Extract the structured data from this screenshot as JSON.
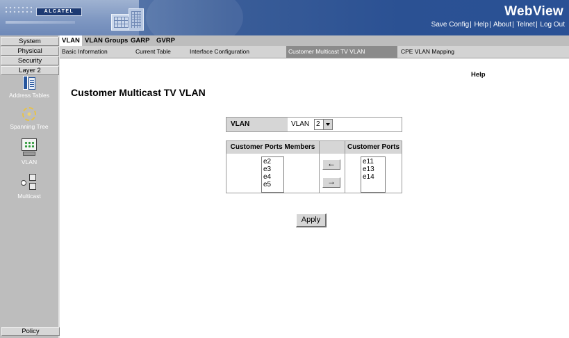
{
  "header": {
    "logo_text": "ALCATEL",
    "title": "WebView",
    "links": [
      "Save Config",
      "Help",
      "About",
      "Telnet",
      "Log Out"
    ]
  },
  "leftnav": {
    "buttons": [
      "System",
      "Physical",
      "Security",
      "Layer 2"
    ],
    "icons": [
      {
        "label": "Address Tables",
        "icon": "address-table-icon"
      },
      {
        "label": "Spanning Tree",
        "icon": "spanning-tree-icon"
      },
      {
        "label": "VLAN",
        "icon": "vlan-icon"
      },
      {
        "label": "Multicast",
        "icon": "multicast-icon"
      }
    ],
    "policy": "Policy"
  },
  "tabs": [
    "VLAN",
    "VLAN Groups",
    "GARP",
    "GVRP"
  ],
  "active_tab": "VLAN",
  "subtabs": [
    "Basic Information",
    "Current Table",
    "Interface Configuration",
    "Customer Multicast TV VLAN",
    "CPE VLAN Mapping"
  ],
  "active_subtab": "Customer Multicast TV VLAN",
  "help": "Help",
  "page_title": "Customer Multicast TV VLAN",
  "vlan": {
    "label": "VLAN",
    "prefix": "VLAN",
    "selected": "2"
  },
  "ports": {
    "members_header": "Customer Ports Members",
    "ports_header": "Customer Ports",
    "members": [
      "e2",
      "e3",
      "e4",
      "e5"
    ],
    "available": [
      "e11",
      "e13",
      "e14"
    ],
    "left_arrow": "←",
    "right_arrow": "→"
  },
  "apply": "Apply",
  "colors": {
    "header_blue": "#2a5195",
    "nav_gray": "#bdbdbd",
    "active_subtab": "#8b8b8b"
  }
}
